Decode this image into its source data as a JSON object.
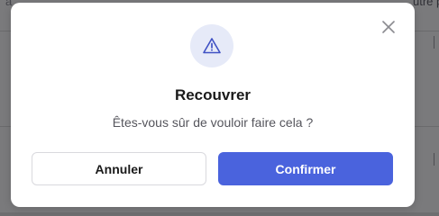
{
  "background": {
    "top_right_fragment": "utre p",
    "top_left_fragment": "â"
  },
  "dialog": {
    "title": "Recouvrer",
    "message": "Êtes-vous sûr de vouloir faire cela ?",
    "icon": "warning-triangle-icon",
    "close_icon": "close-icon",
    "cancel_label": "Annuler",
    "confirm_label": "Confirmer"
  },
  "colors": {
    "accent": "#4a63dd",
    "icon_circle_bg": "#e6eaf8",
    "overlay": "#7a7a7c"
  }
}
